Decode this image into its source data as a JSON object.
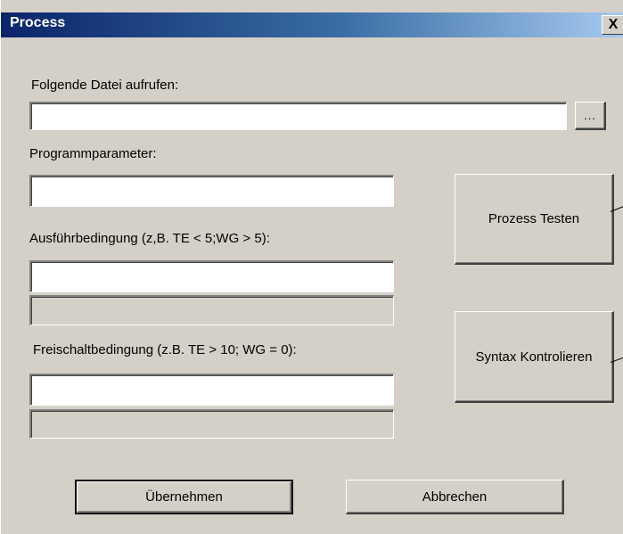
{
  "window": {
    "title": "Process",
    "close_symbol": "X"
  },
  "file": {
    "label": "Folgende Datei aufrufen:",
    "value": "",
    "browse_label": "..."
  },
  "params": {
    "label": "Programmparameter:",
    "value": ""
  },
  "exec_condition": {
    "label": "Ausführbedingung (z,B. TE < 5;WG > 5):",
    "value": "",
    "status": ""
  },
  "enable_condition": {
    "label": "Freischaltbedingung (z.B. TE > 10; WG = 0):",
    "value": "",
    "status": ""
  },
  "buttons": {
    "test": "Prozess Testen",
    "syntax": "Syntax Kontrolieren",
    "apply": "Übernehmen",
    "cancel": "Abbrechen"
  }
}
